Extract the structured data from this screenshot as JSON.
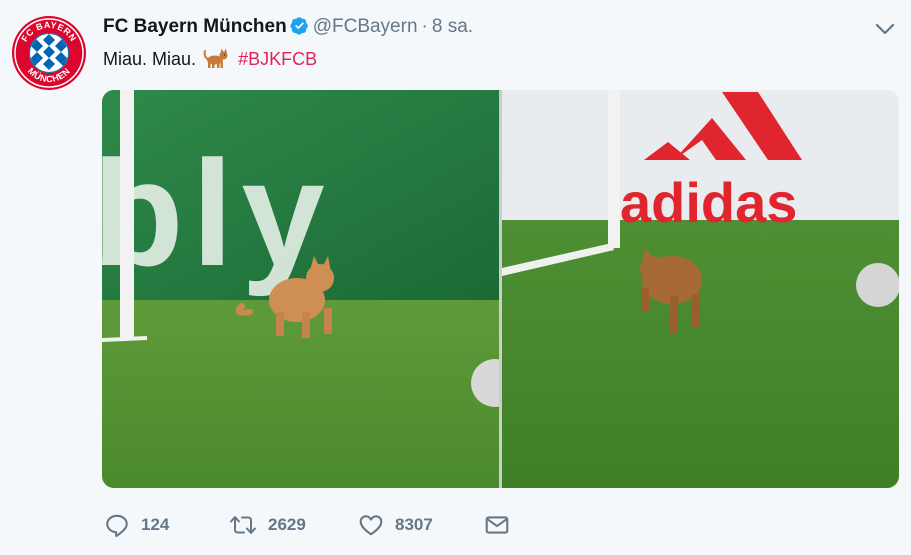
{
  "tweet": {
    "display_name": "FC Bayern München",
    "handle": "@FCBayern",
    "separator": "·",
    "time": "8 sa.",
    "text_prefix": "Miau. Miau.",
    "emoji": "cat-emoji",
    "hashtag": "#BJKFCB"
  },
  "avatar": {
    "ring_text_top": "FC BAYERN",
    "ring_text_bottom": "MÜNCHEN"
  },
  "photos": {
    "left_board_text": "bly",
    "right_board_text": "adidas"
  },
  "actions": {
    "reply_count": "124",
    "retweet_count": "2629",
    "like_count": "8307"
  },
  "colors": {
    "hashtag": "#e0245e",
    "verified": "#1da1f2",
    "muted": "#657786",
    "club_red": "#dc052d",
    "club_blue": "#0066b2"
  }
}
